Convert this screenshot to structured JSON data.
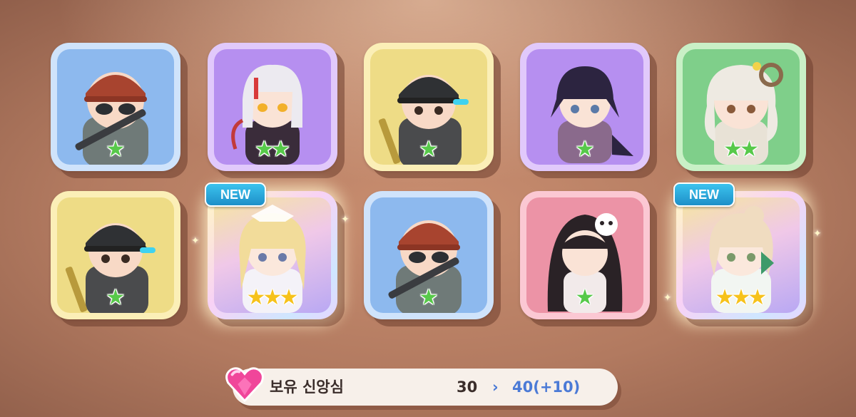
{
  "cards": [
    {
      "name": "card-1",
      "bg": "blue",
      "stars": 1,
      "star_color": "green",
      "is_new": false
    },
    {
      "name": "card-2",
      "bg": "purple",
      "stars": 2,
      "star_color": "green",
      "is_new": false
    },
    {
      "name": "card-3",
      "bg": "yellow",
      "stars": 1,
      "star_color": "green",
      "is_new": false
    },
    {
      "name": "card-4",
      "bg": "purple",
      "stars": 1,
      "star_color": "green",
      "is_new": false
    },
    {
      "name": "card-5",
      "bg": "green",
      "stars": 2,
      "star_color": "green",
      "is_new": false
    },
    {
      "name": "card-6",
      "bg": "yellow",
      "stars": 1,
      "star_color": "green",
      "is_new": false
    },
    {
      "name": "card-7",
      "bg": "rainbow",
      "stars": 3,
      "star_color": "gold",
      "is_new": true
    },
    {
      "name": "card-8",
      "bg": "blue",
      "stars": 1,
      "star_color": "green",
      "is_new": false
    },
    {
      "name": "card-9",
      "bg": "pink",
      "stars": 1,
      "star_color": "green",
      "is_new": false
    },
    {
      "name": "card-10",
      "bg": "rainbow",
      "stars": 3,
      "star_color": "gold",
      "is_new": true
    }
  ],
  "badge_label": "NEW",
  "star_glyph": "★",
  "status_bar": {
    "icon": "heart-gem-icon",
    "label": "보유 신앙심",
    "current": "30",
    "arrow": "›",
    "next": "40(+10)"
  },
  "colors": {
    "background": "#b27a60",
    "accent_blue": "#4b7ad6",
    "badge": "#1d8fc8",
    "heart": "#f0469a"
  }
}
